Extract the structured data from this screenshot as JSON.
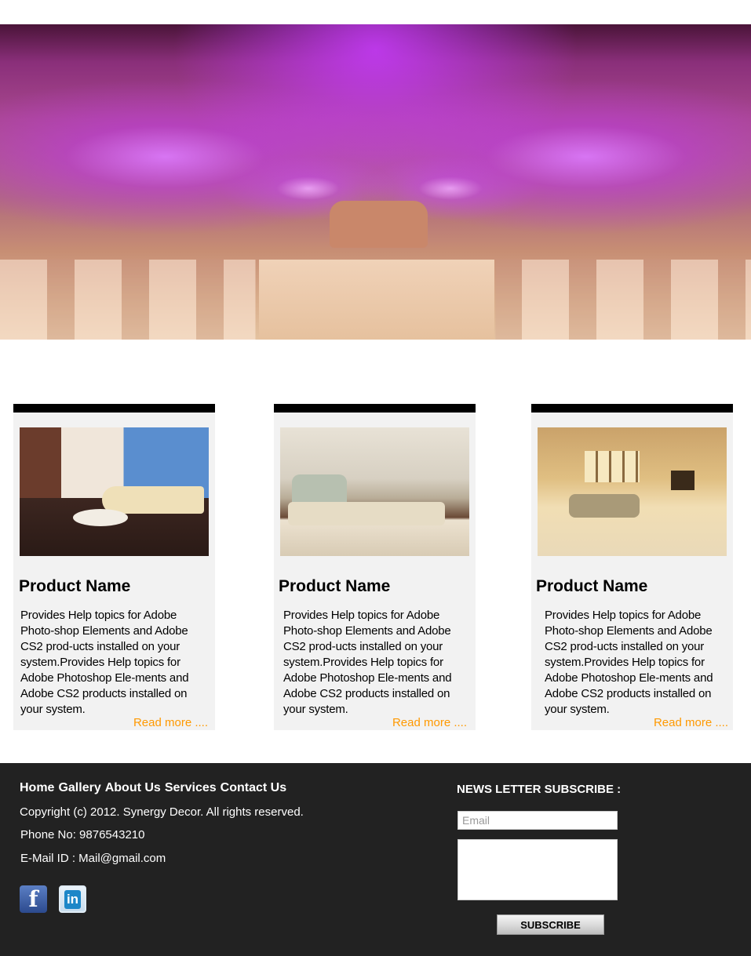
{
  "hero": {
    "image_alt": "Decorated wedding stage with purple lighting"
  },
  "cards": [
    {
      "title": "Product Name",
      "description": "Provides Help topics for Adobe Photo-shop Elements and Adobe CS2 prod-ucts installed on your system.Provides Help topics for Adobe Photoshop Ele-ments and Adobe CS2 products installed on your system.",
      "read_more": "Read more ...."
    },
    {
      "title": "Product Name",
      "description": "Provides Help topics for Adobe Photo-shop Elements and Adobe CS2 prod-ucts installed on your system.Provides Help topics for Adobe Photoshop Ele-ments and Adobe CS2 products installed on your system.",
      "read_more": "Read more ...."
    },
    {
      "title": "Product Name",
      "description": "Provides Help topics for Adobe Photo-shop Elements and Adobe CS2 prod-ucts installed on your system.Provides Help topics for Adobe Photoshop Ele-ments and Adobe CS2 products installed on your system.",
      "read_more": "Read more ...."
    }
  ],
  "footer": {
    "nav": [
      "Home",
      "Gallery",
      "About Us",
      "Services",
      "Contact Us"
    ],
    "copyright": "Copyright (c) 2012. Synergy Decor. All rights reserved.",
    "phone": "Phone No: 9876543210",
    "email": "E-Mail ID : Mail@gmail.com",
    "social": [
      {
        "name": "facebook-icon",
        "glyph": "f"
      },
      {
        "name": "linkedin-icon",
        "glyph": "in"
      }
    ],
    "newsletter": {
      "title": "NEWS LETTER SUBSCRIBE :",
      "email_placeholder": "Email",
      "subscribe_label": "SUBSCRIBE"
    }
  },
  "colors": {
    "accent": "#ff9900",
    "card_bg": "#f2f2f2",
    "card_bar": "#000000",
    "footer_bg": "#222222"
  }
}
